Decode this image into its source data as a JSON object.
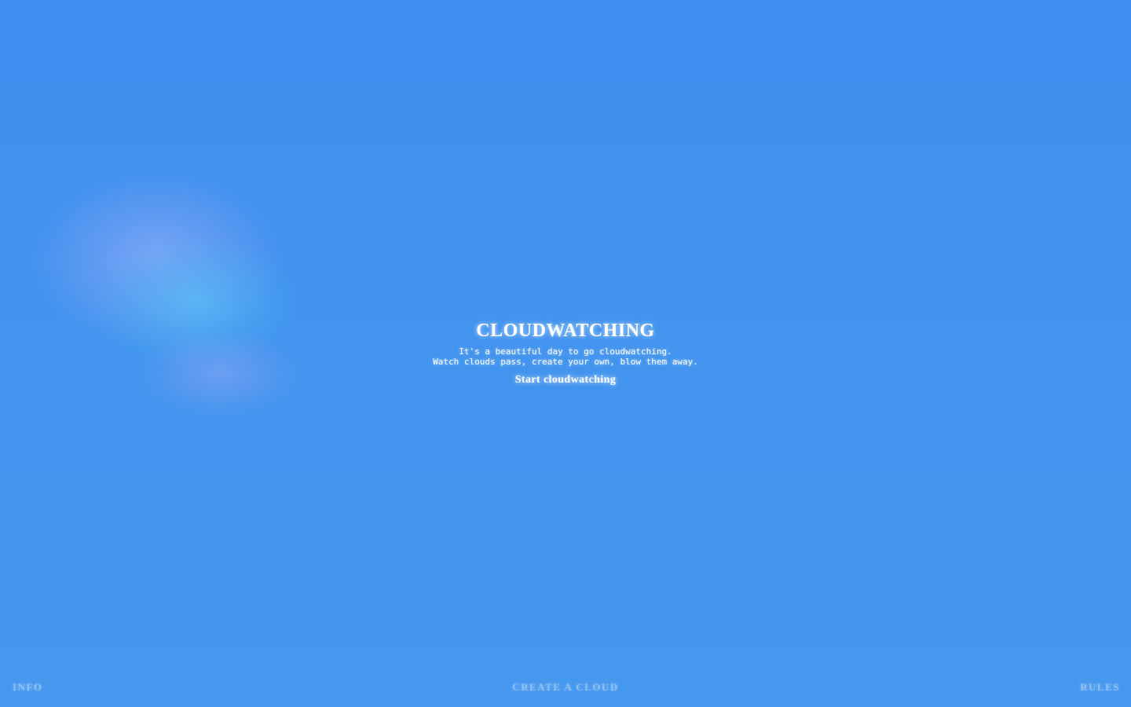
{
  "app": {
    "title": "CLOUDWATCHING",
    "tagline_line1": "It's a beautiful day to go cloudwatching.",
    "tagline_line2": "Watch clouds pass, create your own, blow them away.",
    "start_label": "Start cloudwatching"
  },
  "footer": {
    "left_label": "INFO",
    "center_label": "CREATE A CLOUD",
    "right_label": "RULES"
  },
  "colors": {
    "sky": "#4294ef",
    "text": "#ffffff"
  }
}
